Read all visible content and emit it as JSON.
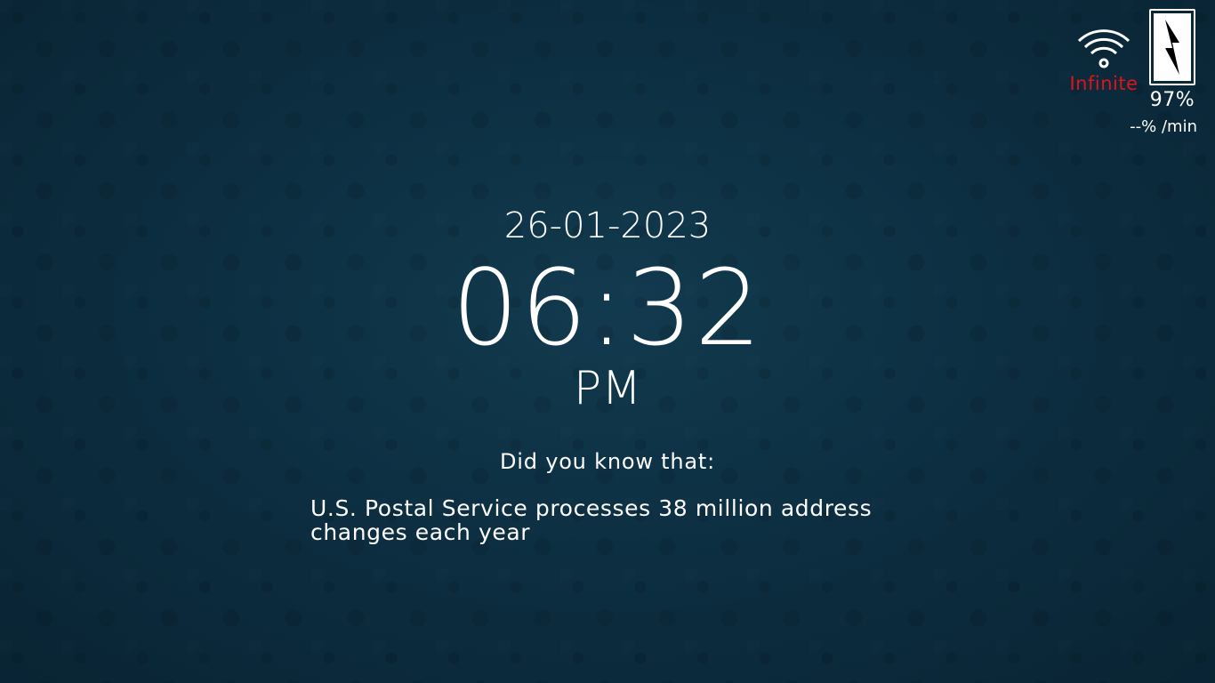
{
  "status": {
    "wifi_label": "Infinite",
    "wifi_label_color": "#e0131b",
    "wifi_icon": "wifi-icon",
    "battery_icon": "battery-charging-icon",
    "battery_percent": "97%",
    "battery_rate": "--% /min"
  },
  "clock": {
    "date": "26-01-2023",
    "time": "06:32",
    "ampm": "PM"
  },
  "fact": {
    "title": "Did you know that:",
    "text": "U.S. Postal Service processes 38 million address changes each year"
  },
  "colors": {
    "background": "#0d2f42",
    "text": "#ffffff"
  }
}
